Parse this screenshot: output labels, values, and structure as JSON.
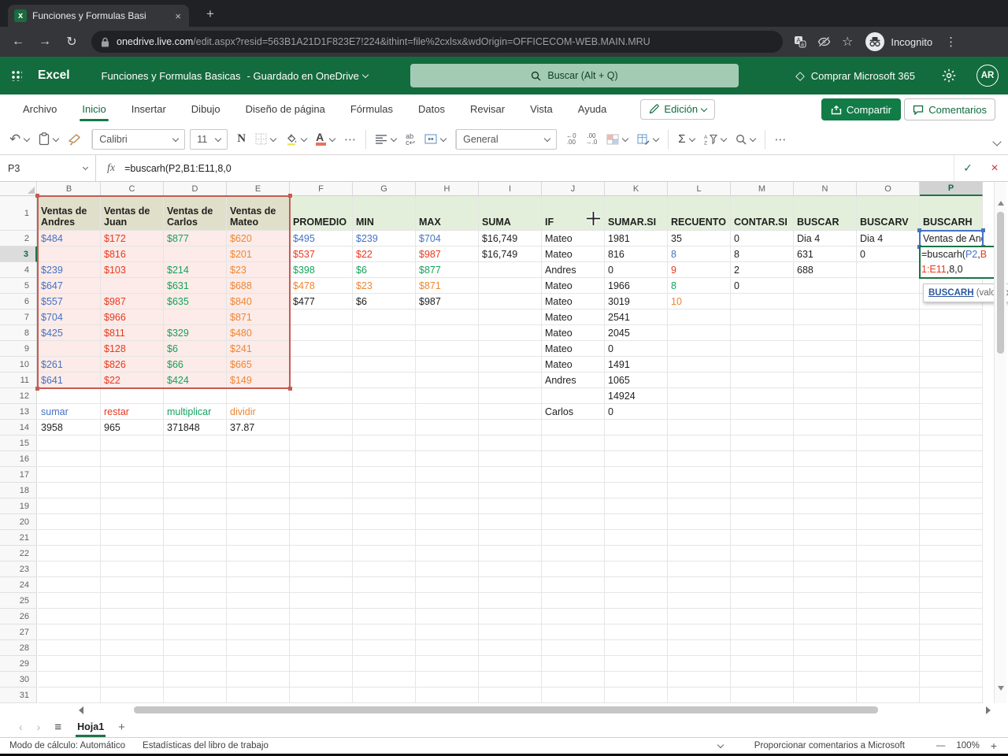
{
  "browser": {
    "tab_title": "Funciones y Formulas Basi",
    "close_glyph": "×",
    "new_tab_glyph": "+",
    "back_glyph": "←",
    "forward_glyph": "→",
    "reload_glyph": "↻",
    "url_domain": "onedrive.live.com",
    "url_path": "/edit.aspx?resid=563B1A21D1F823E7!224&ithint=file%2cxlsx&wdOrigin=OFFICECOM-WEB.MAIN.MRU",
    "star_glyph": "☆",
    "incognito_label": "Incognito",
    "menu_glyph": "⋮"
  },
  "header": {
    "app_name": "Excel",
    "doc_title": "Funciones y Formulas Basicas",
    "saved_status": "-  Guardado en OneDrive",
    "search_placeholder": "Buscar (Alt + Q)",
    "buy_glyph": "◇",
    "buy_label": "Comprar Microsoft 365",
    "avatar_initials": "AR"
  },
  "ribbon": {
    "tabs": [
      "Archivo",
      "Inicio",
      "Insertar",
      "Dibujo",
      "Diseño de página",
      "Fórmulas",
      "Datos",
      "Revisar",
      "Vista",
      "Ayuda"
    ],
    "active_tab": "Inicio",
    "edit_mode_label": "Edición",
    "share_label": "Compartir",
    "comments_label": "Comentarios",
    "undo_glyph": "↶",
    "font_name": "Calibri",
    "font_size": "11",
    "bold_label": "N",
    "font_color_label": "A",
    "more_glyph": "⋯",
    "number_format": "General",
    "inc_decimal": "←0\n.00",
    "dec_decimal": ".00\n→.0",
    "sum_glyph": "Σ",
    "collapse_glyph": ""
  },
  "formula_bar": {
    "name_box": "P3",
    "fx_label": "fx",
    "formula": "=buscarh(P2,B1:E11,8,0",
    "confirm_glyph": "✓",
    "cancel_glyph": "×"
  },
  "sheet": {
    "columns": [
      "B",
      "C",
      "D",
      "E",
      "F",
      "G",
      "H",
      "I",
      "J",
      "K",
      "L",
      "M",
      "N",
      "O",
      "P"
    ],
    "row_count": 31,
    "selected_column": "P",
    "selected_row": 3,
    "colors": {
      "k": "#1f1f1f",
      "b": "#4472c4",
      "r": "#e8391f",
      "g": "#14a25c",
      "o": "#ee8633"
    },
    "fills": {
      "olive": "#dfdfca",
      "green": "#e3efdb",
      "pink": "#fcebe8"
    },
    "range_border_color": "#c65b52",
    "ref_cell_border_color": "#4472c4",
    "edit_border_color": "#1a7343",
    "cells": {
      "B1": [
        "Ventas de Andres",
        "k"
      ],
      "C1": [
        "Ventas de Juan",
        "k"
      ],
      "D1": [
        "Ventas de Carlos",
        "k"
      ],
      "E1": [
        "Ventas de Mateo",
        "k"
      ],
      "F1": [
        "PROMEDIO",
        "k"
      ],
      "G1": [
        "MIN",
        "k"
      ],
      "H1": [
        "MAX",
        "k"
      ],
      "I1": [
        "SUMA",
        "k"
      ],
      "J1": [
        "IF",
        "k"
      ],
      "K1": [
        "SUMAR.SI",
        "k"
      ],
      "L1": [
        "RECUENTO",
        "k"
      ],
      "M1": [
        "CONTAR.SI",
        "k"
      ],
      "N1": [
        "BUSCAR",
        "k"
      ],
      "O1": [
        "BUSCARV",
        "k"
      ],
      "P1": [
        "BUSCARH",
        "k"
      ],
      "B2": [
        "$484",
        "b"
      ],
      "C2": [
        "$172",
        "r"
      ],
      "D2": [
        "$877",
        "g"
      ],
      "E2": [
        "$620",
        "o"
      ],
      "F2": [
        "$495",
        "b"
      ],
      "G2": [
        "$239",
        "b"
      ],
      "H2": [
        "$704",
        "b"
      ],
      "I2": [
        "$16,749",
        "k"
      ],
      "J2": [
        "Mateo",
        "k"
      ],
      "K2": [
        "1981",
        "k"
      ],
      "L2": [
        "35",
        "k"
      ],
      "M2": [
        "0",
        "k"
      ],
      "N2": [
        "Dia 4",
        "k"
      ],
      "O2": [
        "Dia 4",
        "k"
      ],
      "P2": [
        "Ventas de Andres",
        "k"
      ],
      "C3": [
        "$816",
        "r"
      ],
      "E3": [
        "$201",
        "o"
      ],
      "F3": [
        "$537",
        "r"
      ],
      "G3": [
        "$22",
        "r"
      ],
      "H3": [
        "$987",
        "r"
      ],
      "I3": [
        "$16,749",
        "k"
      ],
      "J3": [
        "Mateo",
        "k"
      ],
      "K3": [
        "816",
        "k"
      ],
      "L3": [
        "8",
        "b"
      ],
      "M3": [
        "8",
        "k"
      ],
      "N3": [
        "631",
        "k"
      ],
      "O3": [
        "0",
        "k"
      ],
      "B4": [
        "$239",
        "b"
      ],
      "C4": [
        "$103",
        "r"
      ],
      "D4": [
        "$214",
        "g"
      ],
      "E4": [
        "$23",
        "o"
      ],
      "F4": [
        "$398",
        "g"
      ],
      "G4": [
        "$6",
        "g"
      ],
      "H4": [
        "$877",
        "g"
      ],
      "J4": [
        "Andres",
        "k"
      ],
      "K4": [
        "0",
        "k"
      ],
      "L4": [
        "9",
        "r"
      ],
      "M4": [
        "2",
        "k"
      ],
      "N4": [
        "688",
        "k"
      ],
      "B5": [
        "$647",
        "b"
      ],
      "D5": [
        "$631",
        "g"
      ],
      "E5": [
        "$688",
        "o"
      ],
      "F5": [
        "$478",
        "o"
      ],
      "G5": [
        "$23",
        "o"
      ],
      "H5": [
        "$871",
        "o"
      ],
      "J5": [
        "Mateo",
        "k"
      ],
      "K5": [
        "1966",
        "k"
      ],
      "L5": [
        "8",
        "g"
      ],
      "M5": [
        "0",
        "k"
      ],
      "B6": [
        "$557",
        "b"
      ],
      "C6": [
        "$987",
        "r"
      ],
      "D6": [
        "$635",
        "g"
      ],
      "E6": [
        "$840",
        "o"
      ],
      "F6": [
        "$477",
        "k"
      ],
      "G6": [
        "$6",
        "k"
      ],
      "H6": [
        "$987",
        "k"
      ],
      "J6": [
        "Mateo",
        "k"
      ],
      "K6": [
        "3019",
        "k"
      ],
      "L6": [
        "10",
        "o"
      ],
      "B7": [
        "$704",
        "b"
      ],
      "C7": [
        "$966",
        "r"
      ],
      "E7": [
        "$871",
        "o"
      ],
      "J7": [
        "Mateo",
        "k"
      ],
      "K7": [
        "2541",
        "k"
      ],
      "B8": [
        "$425",
        "b"
      ],
      "C8": [
        "$811",
        "r"
      ],
      "D8": [
        "$329",
        "g"
      ],
      "E8": [
        "$480",
        "o"
      ],
      "J8": [
        "Mateo",
        "k"
      ],
      "K8": [
        "2045",
        "k"
      ],
      "C9": [
        "$128",
        "r"
      ],
      "D9": [
        "$6",
        "g"
      ],
      "E9": [
        "$241",
        "o"
      ],
      "J9": [
        "Mateo",
        "k"
      ],
      "K9": [
        "0",
        "k"
      ],
      "B10": [
        "$261",
        "b"
      ],
      "C10": [
        "$826",
        "r"
      ],
      "D10": [
        "$66",
        "g"
      ],
      "E10": [
        "$665",
        "o"
      ],
      "J10": [
        "Mateo",
        "k"
      ],
      "K10": [
        "1491",
        "k"
      ],
      "B11": [
        "$641",
        "b"
      ],
      "C11": [
        "$22",
        "r"
      ],
      "D11": [
        "$424",
        "g"
      ],
      "E11": [
        "$149",
        "o"
      ],
      "J11": [
        "Andres",
        "k"
      ],
      "K11": [
        "1065",
        "k"
      ],
      "K12": [
        "14924",
        "k"
      ],
      "B13": [
        "sumar",
        "b"
      ],
      "C13": [
        "restar",
        "r"
      ],
      "D13": [
        "multiplicar",
        "g"
      ],
      "E13": [
        "dividir",
        "o"
      ],
      "J13": [
        "Carlos",
        "k"
      ],
      "K13": [
        "0",
        "k"
      ],
      "B14": [
        "3958",
        "k"
      ],
      "C14": [
        "965",
        "k"
      ],
      "D14": [
        "371848",
        "k"
      ],
      "E14": [
        "37.87",
        "k"
      ]
    },
    "edit_cell": {
      "ref": "P3",
      "parts": [
        [
          "=buscarh(",
          "k"
        ],
        [
          "P2",
          "b"
        ],
        [
          ",",
          "k"
        ],
        [
          "B1:E11",
          "r"
        ],
        [
          ",8,0",
          "k"
        ]
      ]
    },
    "tooltip": {
      "function_name": "BUSCARH",
      "args_hint": " (valor_busc"
    }
  },
  "bottom": {
    "prev_sheet_glyph": "‹",
    "next_sheet_glyph": "›",
    "sheet_list_glyph": "≡",
    "sheet_name": "Hoja1",
    "add_sheet_glyph": "+",
    "calc_mode": "Modo de cálculo: Automático",
    "workbook_stats": "Estadísticas del libro de trabajo",
    "feedback": "Proporcionar comentarios a Microsoft",
    "zoom_out_glyph": "—",
    "zoom_level": "100%",
    "zoom_in_glyph": "+"
  }
}
